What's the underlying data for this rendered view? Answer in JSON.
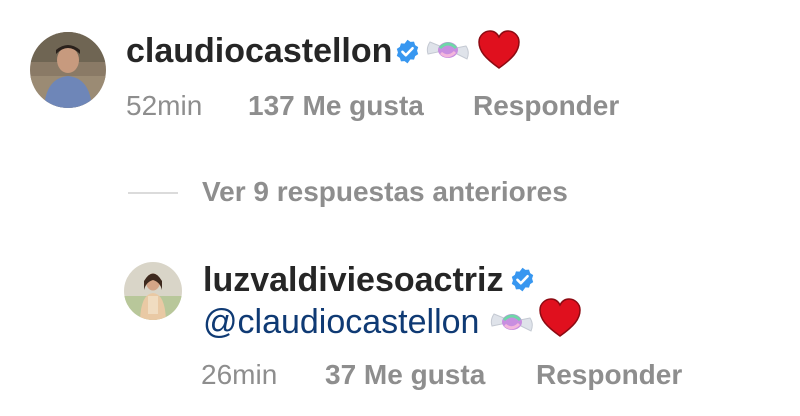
{
  "comment": {
    "username": "claudiocastellon",
    "time": "52min",
    "likes": "137 Me gusta",
    "reply_label": "Responder",
    "icons": [
      "verified-badge",
      "candy-emoji",
      "red-heart-emoji"
    ]
  },
  "thread": {
    "view_replies_label": "Ver 9 respuestas anteriores"
  },
  "reply": {
    "username": "luzvaldiviesoactriz",
    "mention": "@claudiocastellon",
    "time": "26min",
    "likes": "37 Me gusta",
    "reply_label": "Responder",
    "icons": [
      "verified-badge",
      "candy-emoji",
      "red-heart-emoji"
    ]
  },
  "colors": {
    "username": "#262626",
    "meta": "#8e8e8e",
    "mention": "#0f3a74",
    "verified": "#3897f0",
    "heart": "#e0101e"
  }
}
